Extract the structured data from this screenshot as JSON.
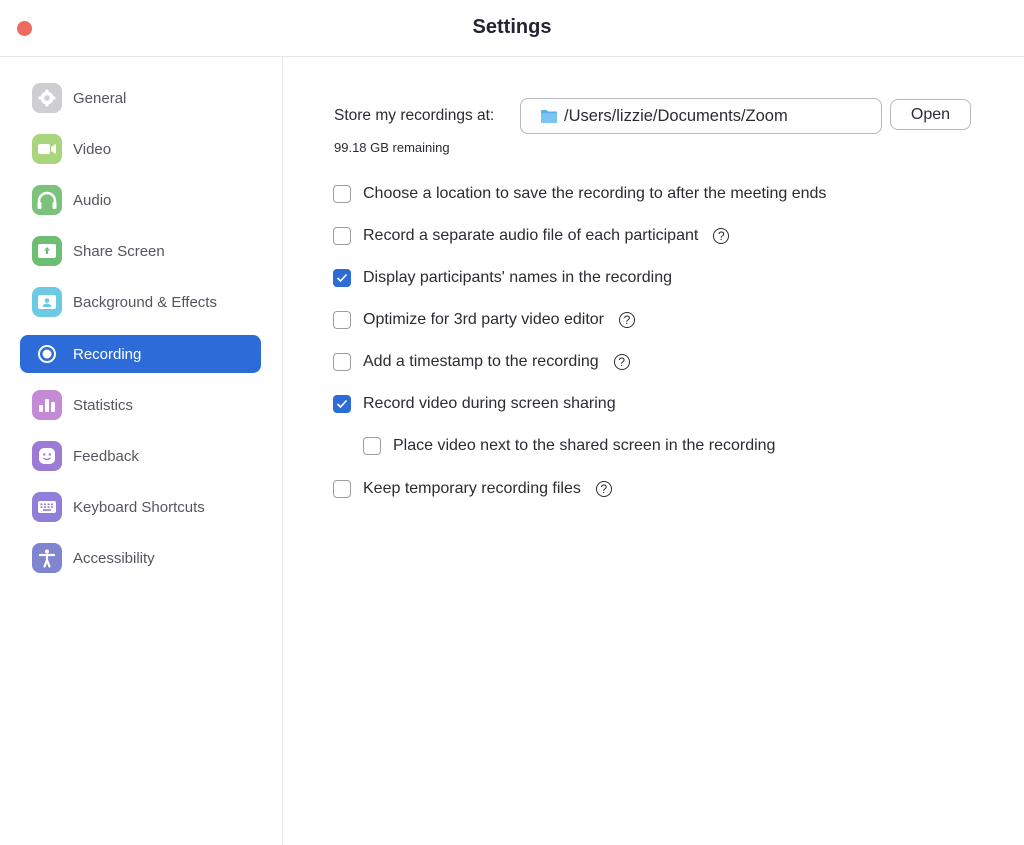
{
  "window": {
    "title": "Settings",
    "close_button_color": "#ec6a5e"
  },
  "sidebar": {
    "items": [
      {
        "label": "General",
        "icon": "gear-icon",
        "color": "#cfcfd3",
        "active": false
      },
      {
        "label": "Video",
        "icon": "video-camera-icon",
        "color": "#a8d57e",
        "active": false
      },
      {
        "label": "Audio",
        "icon": "headphones-icon",
        "color": "#7bc37a",
        "active": false
      },
      {
        "label": "Share Screen",
        "icon": "share-screen-icon",
        "color": "#6dbd73",
        "active": false
      },
      {
        "label": "Background & Effects",
        "icon": "background-icon",
        "color": "#6ccbe3",
        "active": false
      },
      {
        "label": "Recording",
        "icon": "record-icon",
        "color": "#2d6bd9",
        "active": true
      },
      {
        "label": "Statistics",
        "icon": "bar-chart-icon",
        "color": "#c48ad6",
        "active": false
      },
      {
        "label": "Feedback",
        "icon": "smiley-icon",
        "color": "#9c7bd6",
        "active": false
      },
      {
        "label": "Keyboard Shortcuts",
        "icon": "keyboard-icon",
        "color": "#8f7fd8",
        "active": false
      },
      {
        "label": "Accessibility",
        "icon": "accessibility-icon",
        "color": "#7f86cf",
        "active": false
      }
    ]
  },
  "recording": {
    "store_label": "Store my recordings at:",
    "path": "/Users/lizzie/Documents/Zoom",
    "open_label": "Open",
    "remaining": "99.18 GB remaining",
    "options": [
      {
        "label": "Choose a location to save the recording to after the meeting ends",
        "checked": false,
        "help": false,
        "indent": false
      },
      {
        "label": "Record a separate audio file of each participant",
        "checked": false,
        "help": true,
        "indent": false
      },
      {
        "label": "Display participants' names in the recording",
        "checked": true,
        "help": false,
        "indent": false
      },
      {
        "label": "Optimize for 3rd party video editor",
        "checked": false,
        "help": true,
        "indent": false
      },
      {
        "label": "Add a timestamp to the recording",
        "checked": false,
        "help": true,
        "indent": false
      },
      {
        "label": "Record video during screen sharing",
        "checked": true,
        "help": false,
        "indent": false
      },
      {
        "label": "Place video next to the shared screen in the recording",
        "checked": false,
        "help": false,
        "indent": true
      },
      {
        "label": "Keep temporary recording files",
        "checked": false,
        "help": true,
        "indent": false
      }
    ],
    "help_glyph": "?"
  },
  "accent_color": "#2d6bd9"
}
